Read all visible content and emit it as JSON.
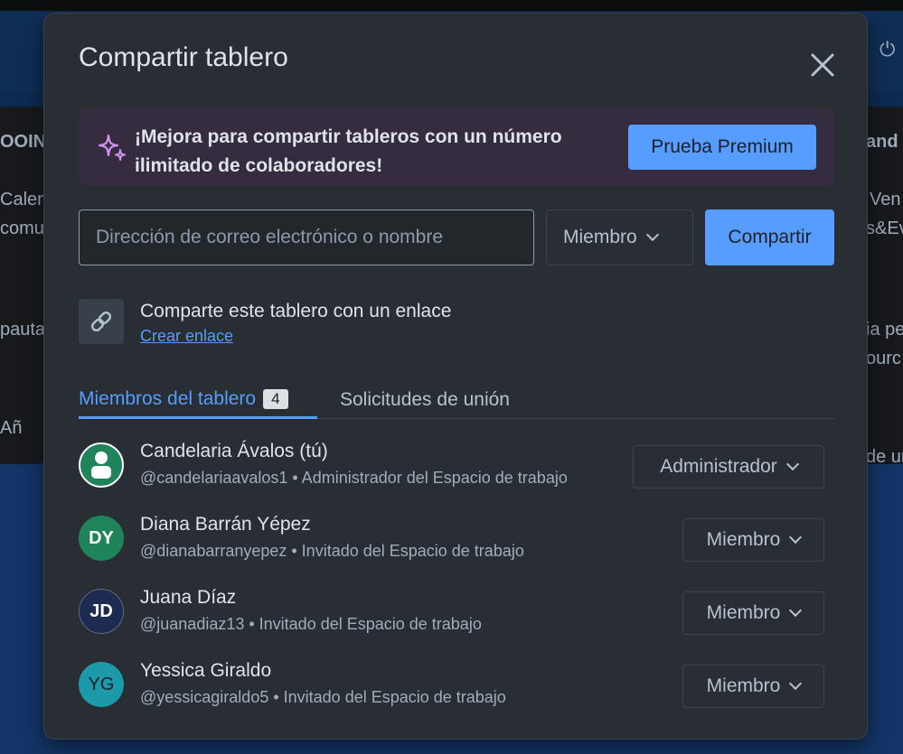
{
  "modal": {
    "title": "Compartir tablero",
    "promo_text": "¡Mejora para compartir tableros con un número ilimitado de colaboradores!",
    "premium_button": "Prueba Premium",
    "email_placeholder": "Dirección de correo electrónico o nombre",
    "role_selected": "Miembro",
    "share_button": "Compartir",
    "link_title": "Comparte este tablero con un enlace",
    "link_action": "Crear enlace"
  },
  "tabs": {
    "members_label": "Miembros del tablero",
    "members_count": "4",
    "requests_label": "Solicitudes de unión"
  },
  "members": [
    {
      "name": "Candelaria Ávalos (tú)",
      "sub": "@candelariaavalos1 • Administrador del Espacio de trabajo",
      "role": "Administrador",
      "initials": "",
      "color": "#1f845a"
    },
    {
      "name": "Diana Barrán Yépez",
      "sub": "@dianabarranyepez • Invitado del Espacio de trabajo",
      "role": "Miembro",
      "initials": "DY",
      "color": "#1f845a"
    },
    {
      "name": "Juana Díaz",
      "sub": "@juanadiaz13 • Invitado del Espacio de trabajo",
      "role": "Miembro",
      "initials": "JD",
      "color": "#1c2b4f"
    },
    {
      "name": "Yessica Giraldo",
      "sub": "@yessicagiraldo5 • Invitado del Espacio de trabajo",
      "role": "Miembro",
      "initials": "YG",
      "color": "#1d9aaa"
    }
  ],
  "background": {
    "frag1": "OOIN",
    "frag2": "Calen",
    "frag3": "comu",
    "frag4": "pauta",
    "frag5": "Añ",
    "frag6": "and",
    "frag7": "Ven",
    "frag8": "s&Ev",
    "frag9": "ia pe",
    "frag10": "ourc",
    "frag11": "de ur"
  },
  "colors": {
    "accent": "#579dff",
    "modal_bg": "#282e33",
    "promo_bg": "#352c3f"
  }
}
